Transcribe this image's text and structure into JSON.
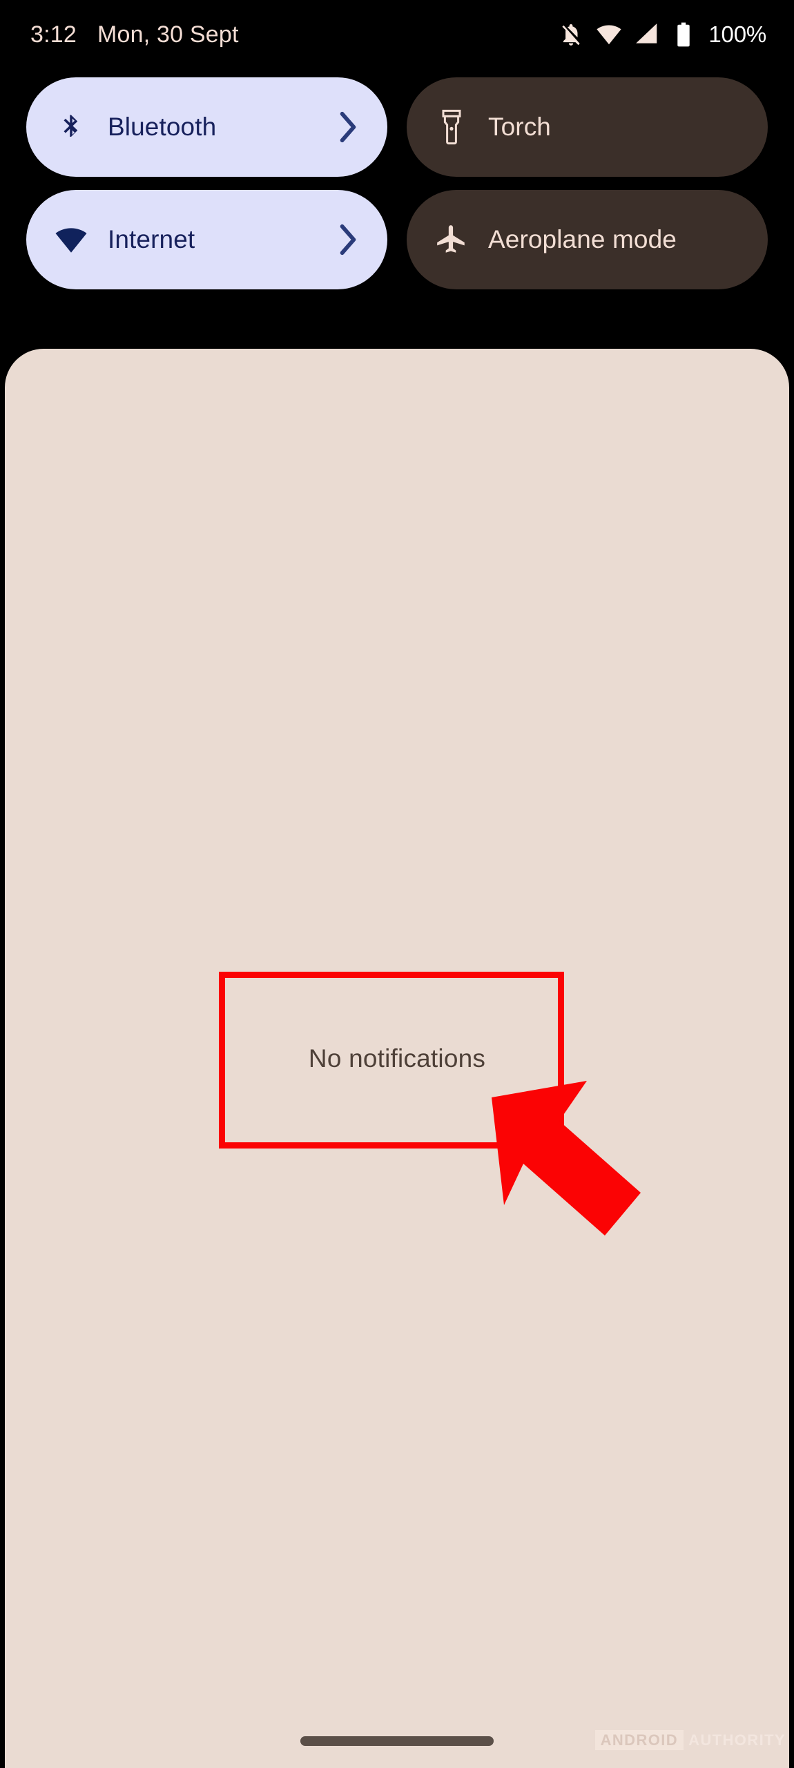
{
  "status_bar": {
    "clock": "3:12",
    "date": "Mon, 30 Sept",
    "battery_percent": "100%",
    "icons": [
      "ringer-vibrate-off-icon",
      "wifi-icon",
      "cellular-signal-icon",
      "battery-icon"
    ]
  },
  "quick_settings": {
    "tiles": [
      {
        "id": "bluetooth",
        "label": "Bluetooth",
        "icon": "bluetooth-icon",
        "state": "active",
        "has_chevron": true
      },
      {
        "id": "torch",
        "label": "Torch",
        "icon": "flashlight-icon",
        "state": "inactive",
        "has_chevron": false
      },
      {
        "id": "internet",
        "label": "Internet",
        "icon": "wifi-icon",
        "state": "active",
        "has_chevron": true
      },
      {
        "id": "aeroplane-mode",
        "label": "Aeroplane mode",
        "icon": "airplane-icon",
        "state": "inactive",
        "has_chevron": false
      }
    ]
  },
  "notification_shade": {
    "empty_message": "No notifications"
  },
  "annotation": {
    "highlight_color": "#fb0304",
    "arrow": "red-arrow-up-left"
  },
  "watermark": {
    "brand": "ANDROID",
    "suffix": "AUTHORITY"
  },
  "colors": {
    "screen_background": "#000000",
    "shade_background": "#eadbd2",
    "tile_active_bg": "#dee0fa",
    "tile_active_fg": "#17215c",
    "tile_inactive_bg": "#3b2f29",
    "tile_inactive_fg": "#f2ded4",
    "notification_text": "#4e4038",
    "home_indicator": "#5b4f48",
    "status_text": "#f3ddd4"
  }
}
